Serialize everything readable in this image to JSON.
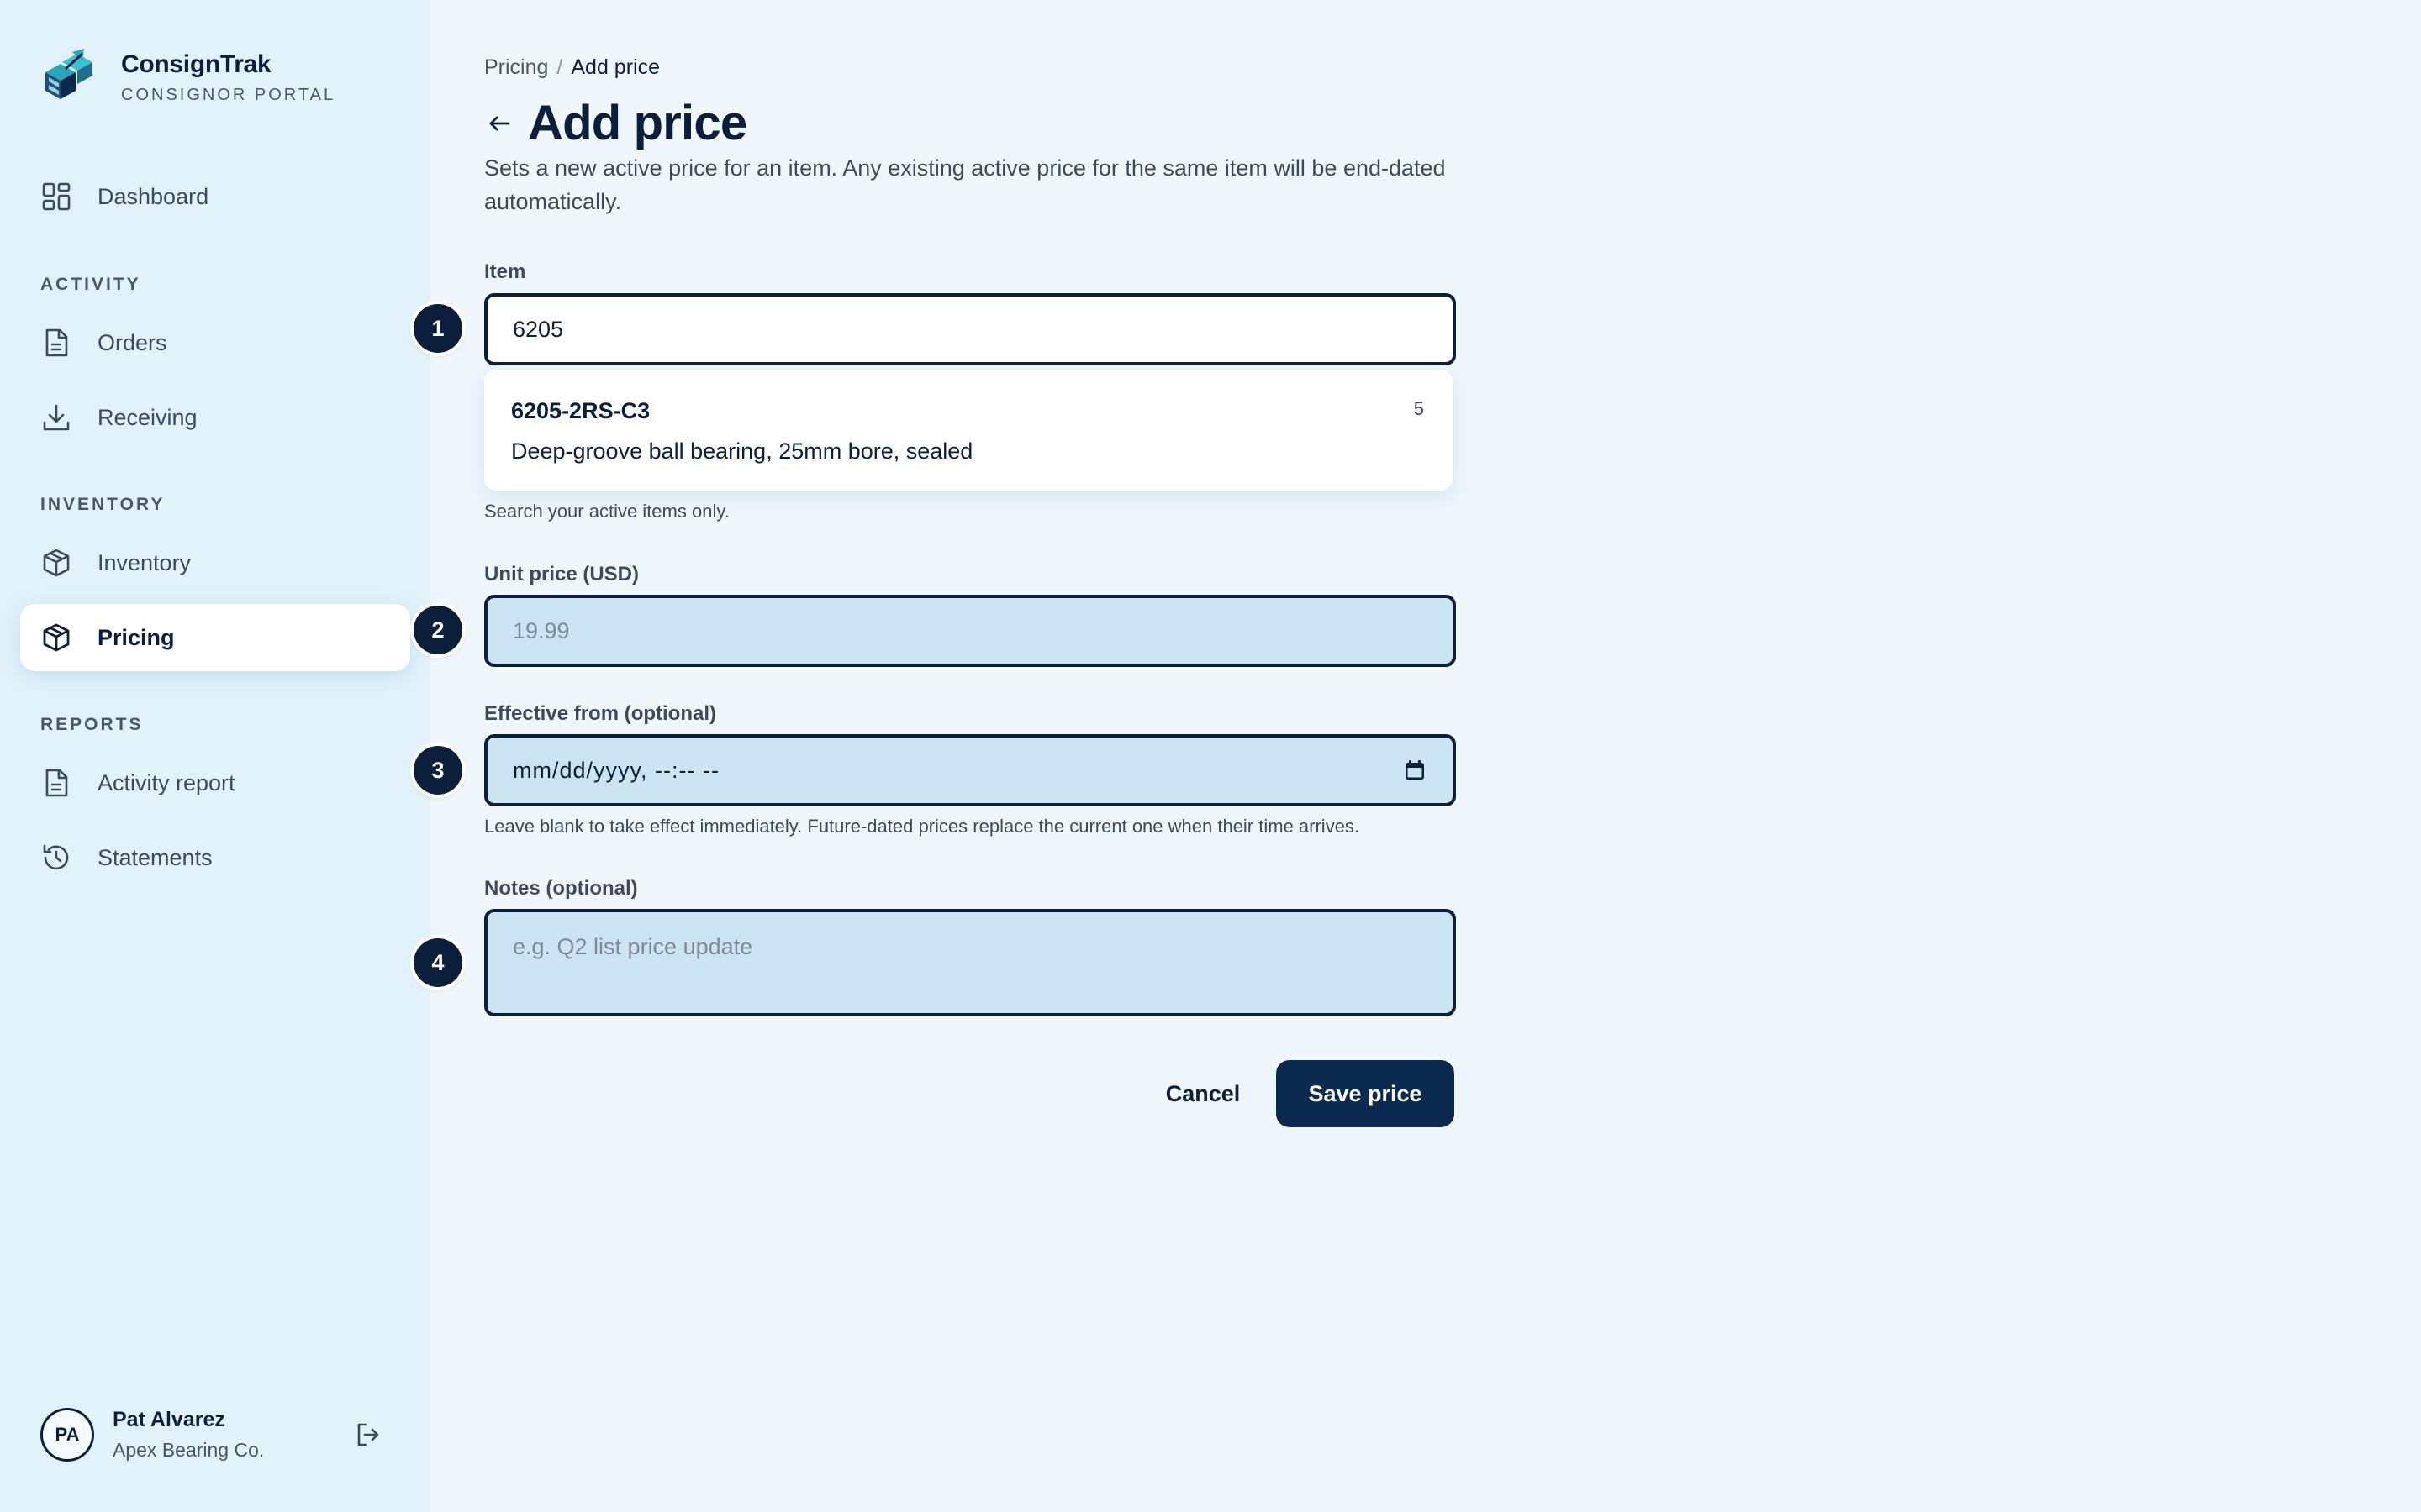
{
  "brand": {
    "name": "ConsignTrak",
    "subtitle": "CONSIGNOR PORTAL",
    "logo_icon": "stacked-boxes-logo-icon"
  },
  "sidebar": {
    "dashboard": {
      "label": "Dashboard",
      "icon": "grid-icon"
    },
    "sections": {
      "activity": "ACTIVITY",
      "inventory": "INVENTORY",
      "reports": "REPORTS"
    },
    "items": {
      "orders": {
        "label": "Orders",
        "icon": "document-icon"
      },
      "receiving": {
        "label": "Receiving",
        "icon": "download-icon"
      },
      "inventory": {
        "label": "Inventory",
        "icon": "box-icon"
      },
      "pricing": {
        "label": "Pricing",
        "icon": "box-icon",
        "active": true
      },
      "activity_report": {
        "label": "Activity report",
        "icon": "document-icon"
      },
      "statements": {
        "label": "Statements",
        "icon": "history-icon"
      }
    },
    "user": {
      "initials": "PA",
      "name": "Pat Alvarez",
      "org": "Apex Bearing Co.",
      "logout_icon": "logout-icon"
    }
  },
  "breadcrumb": {
    "parent": "Pricing",
    "separator": "/",
    "current": "Add price"
  },
  "page": {
    "title": "Add price",
    "description": "Sets a new active price for an item. Any existing active price for the same item will be end-dated automatically."
  },
  "form": {
    "item": {
      "step": "1",
      "label": "Item",
      "value": "6205",
      "hint": "Search your active items only.",
      "suggestions": [
        {
          "sku": "6205-2RS-C3",
          "description": "Deep-groove ball bearing, 25mm bore, sealed",
          "count": "5"
        }
      ]
    },
    "unit_price": {
      "step": "2",
      "label": "Unit price (USD)",
      "placeholder": "19.99",
      "value": ""
    },
    "effective_from": {
      "step": "3",
      "label": "Effective from (optional)",
      "display": "mm/dd/yyyy, --:-- --",
      "hint": "Leave blank to take effect immediately. Future-dated prices replace the current one when their time arrives."
    },
    "notes": {
      "step": "4",
      "label": "Notes (optional)",
      "placeholder": "e.g. Q2 list price update",
      "value": ""
    }
  },
  "actions": {
    "cancel_label": "Cancel",
    "save_label": "Save price"
  },
  "colors": {
    "sidebar_bg": "#e2f2fb",
    "page_bg": "#f0f7fc",
    "primary": "#0b2a4f",
    "input_focus_bg": "#cce3f2",
    "text": "#0b1f3a"
  }
}
